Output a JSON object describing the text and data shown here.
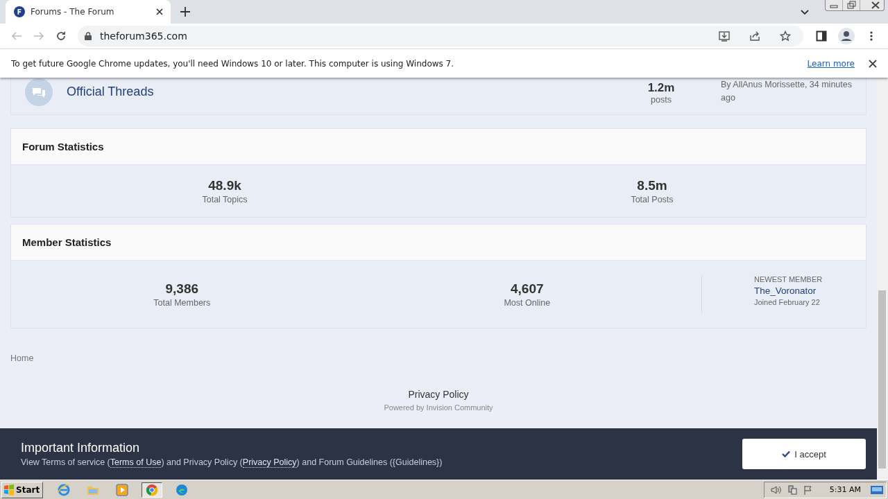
{
  "browser": {
    "tab": {
      "title": "Forums - The Forum"
    },
    "address": "theforum365.com",
    "infobar": {
      "message": "To get future Google Chrome updates, you'll need Windows 10 or later. This computer is using Windows 7.",
      "link": "Learn more"
    }
  },
  "forum_row": {
    "title": "Official Threads",
    "count": "1.2m",
    "count_label": "posts",
    "last_post": "By AllAnus Morissette, 34 minutes ago"
  },
  "forum_statistics": {
    "title": "Forum Statistics",
    "stats": [
      {
        "value": "48.9k",
        "label": "Total Topics"
      },
      {
        "value": "8.5m",
        "label": "Total Posts"
      }
    ]
  },
  "member_statistics": {
    "title": "Member Statistics",
    "stats": [
      {
        "value": "9,386",
        "label": "Total Members"
      },
      {
        "value": "4,607",
        "label": "Most Online"
      }
    ],
    "newest_member": {
      "heading": "NEWEST MEMBER",
      "name": "The_Voronator",
      "joined": "Joined February 22"
    }
  },
  "breadcrumb": "Home",
  "page_footer": {
    "link": "Privacy Policy",
    "powered": "Powered by Invision Community"
  },
  "notice": {
    "title": "Important Information",
    "parts": [
      {
        "kind": "text",
        "text": "View Terms of service ("
      },
      {
        "kind": "link",
        "text": "Terms of Use"
      },
      {
        "kind": "text",
        "text": ") and Privacy Policy ("
      },
      {
        "kind": "link",
        "text": "Privacy Policy"
      },
      {
        "kind": "text",
        "text": ") and Forum Guidelines ({Guidelines})"
      }
    ],
    "accept": "I accept"
  },
  "taskbar": {
    "start": "Start",
    "apps": [
      {
        "kind": "ie",
        "selected": false
      },
      {
        "kind": "folder",
        "selected": false
      },
      {
        "kind": "media",
        "selected": false
      },
      {
        "kind": "chrome",
        "selected": true
      },
      {
        "kind": "edge",
        "selected": false
      }
    ],
    "clock": "5:31 AM"
  }
}
